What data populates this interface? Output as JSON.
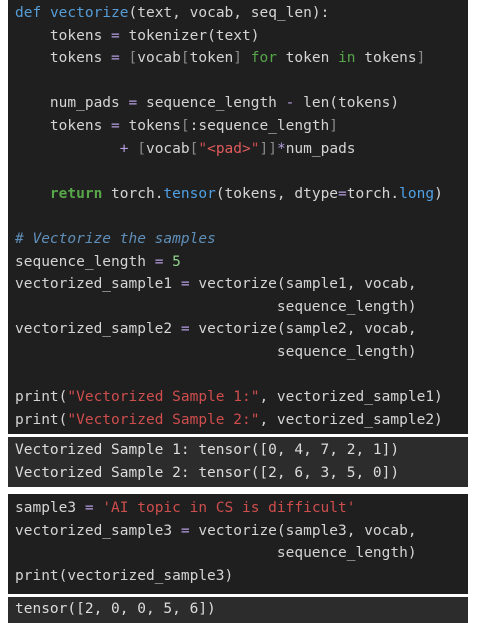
{
  "cell1": {
    "lines": [
      "def vectorize(text, vocab, seq_len):",
      "    tokens = tokenizer(text)",
      "    tokens = [vocab[token] for token in tokens]",
      "",
      "    num_pads = sequence_length - len(tokens)",
      "    tokens = tokens[:sequence_length]",
      "            + [vocab[\"<pad>\"]]*num_pads",
      "",
      "    return torch.tensor(tokens, dtype=torch.long)",
      "",
      "# Vectorize the samples",
      "sequence_length = 5",
      "vectorized_sample1 = vectorize(sample1, vocab,",
      "                              sequence_length)",
      "vectorized_sample2 = vectorize(sample2, vocab,",
      "                              sequence_length)",
      "",
      "print(\"Vectorized Sample 1:\", vectorized_sample1)",
      "print(\"Vectorized Sample 2:\", vectorized_sample2)"
    ]
  },
  "output1": {
    "lines": [
      "Vectorized Sample 1: tensor([0, 4, 7, 2, 1])",
      "Vectorized Sample 2: tensor([2, 6, 3, 5, 0])"
    ]
  },
  "cell2": {
    "lines": [
      "sample3 = 'AI topic in CS is difficult'",
      "vectorized_sample3 = vectorize(sample3, vocab,",
      "                              sequence_length)",
      "print(vectorized_sample3)"
    ]
  },
  "output2": {
    "lines": [
      "tensor([2, 0, 0, 5, 6])"
    ]
  }
}
